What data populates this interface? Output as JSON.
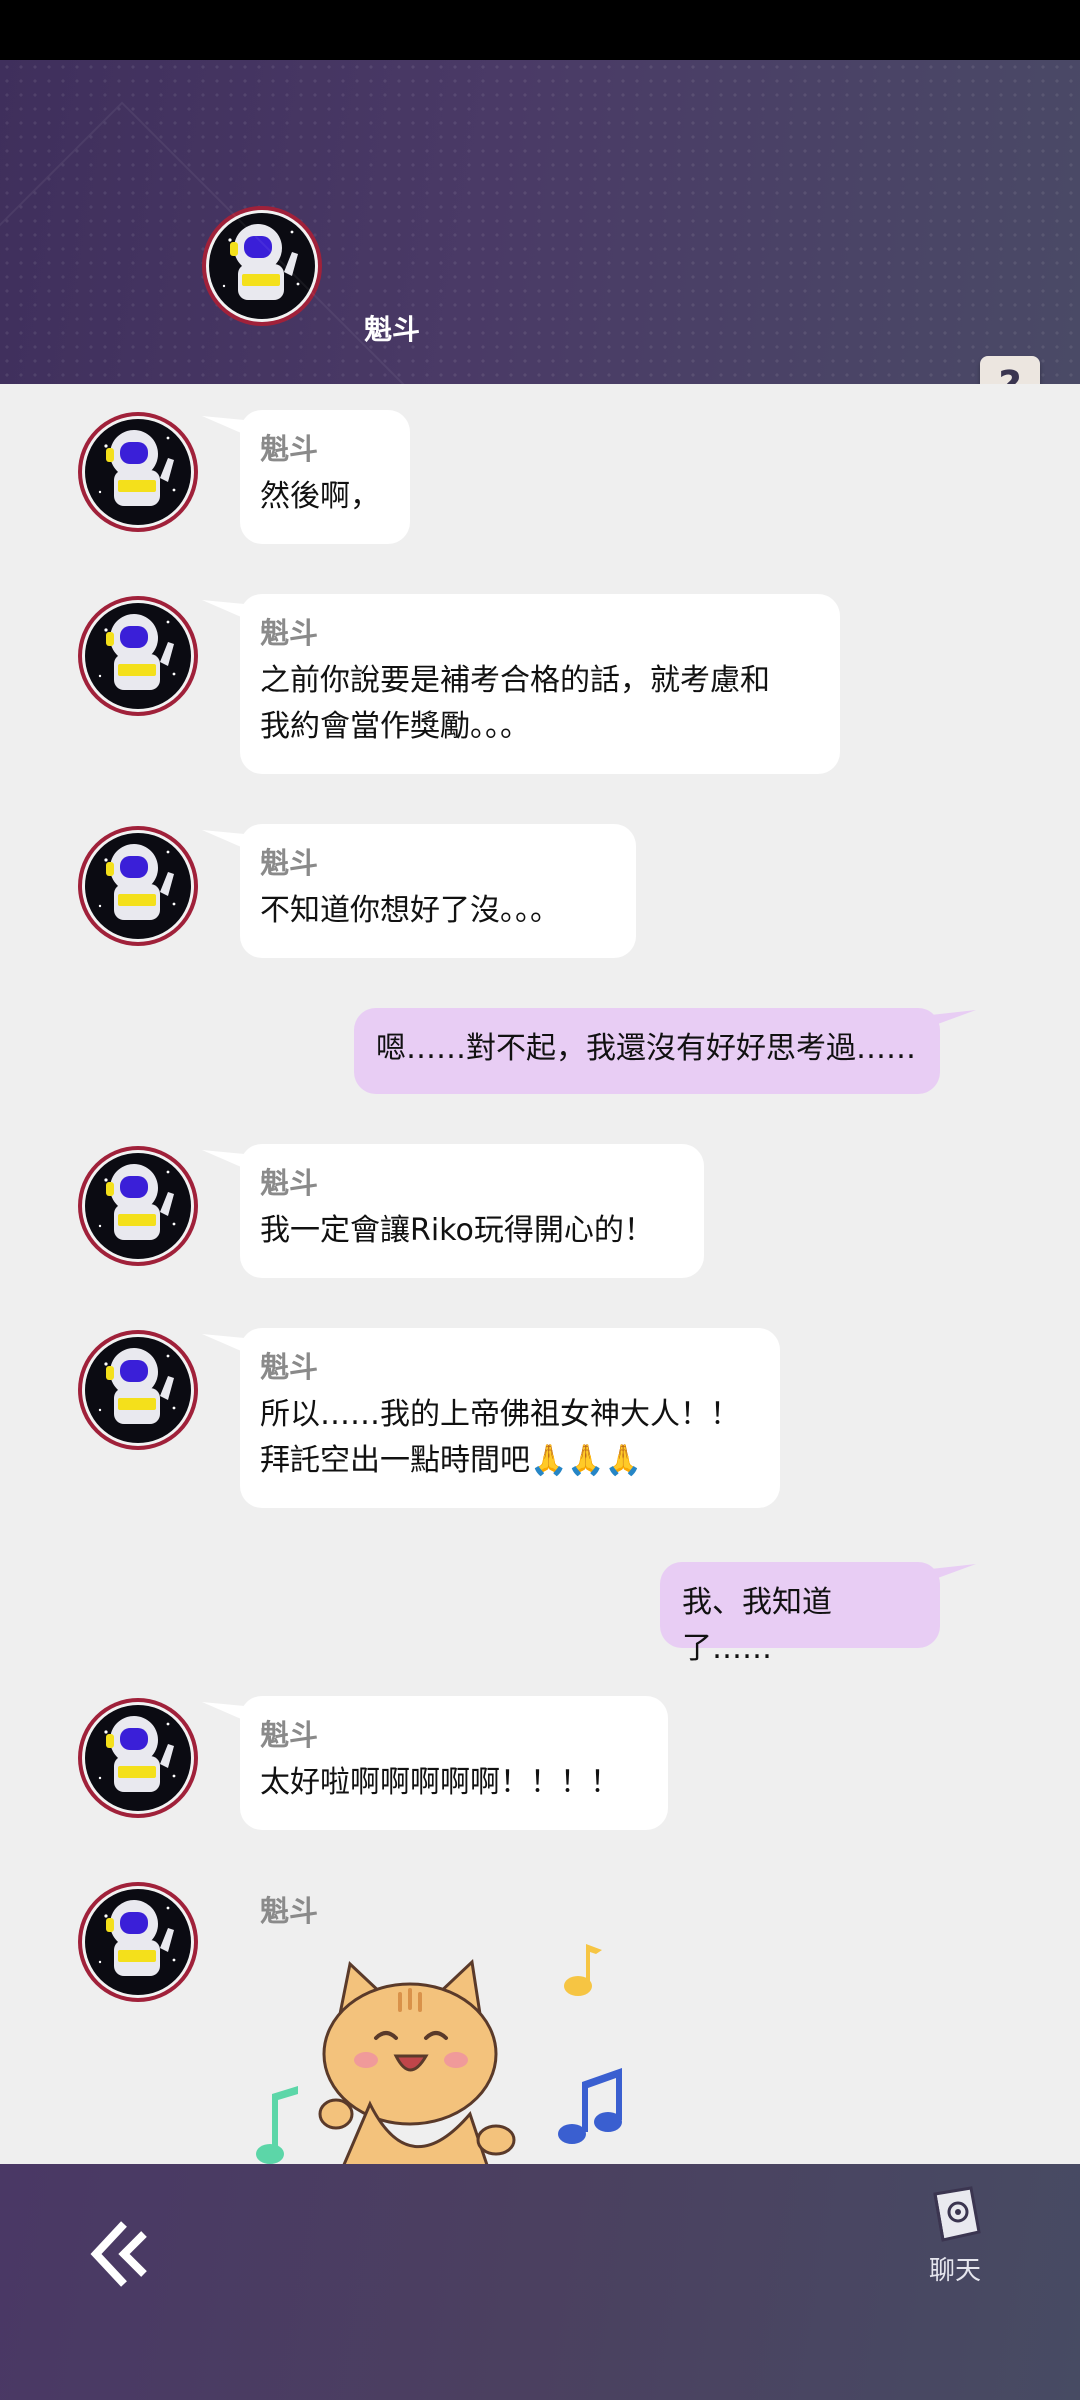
{
  "header": {
    "contact_name": "魁斗",
    "help_label": "?"
  },
  "messages": [
    {
      "side": "left",
      "sender": "魁斗",
      "text": "然後啊，"
    },
    {
      "side": "left",
      "sender": "魁斗",
      "text": "之前你說要是補考合格的話，就考慮和\n我約會當作獎勵。。。"
    },
    {
      "side": "left",
      "sender": "魁斗",
      "text": "不知道你想好了沒。。。"
    },
    {
      "side": "right",
      "text": "嗯……對不起，我還沒有好好思考過……"
    },
    {
      "side": "left",
      "sender": "魁斗",
      "text": "我一定會讓Riko玩得開心的！"
    },
    {
      "side": "left",
      "sender": "魁斗",
      "text": "所以……我的上帝佛祖女神大人！！\n拜託空出一點時間吧🙏🙏🙏"
    },
    {
      "side": "right",
      "text": "我、我知道了……"
    },
    {
      "side": "left",
      "sender": "魁斗",
      "text": "太好啦啊啊啊啊啊！！！！"
    },
    {
      "side": "left",
      "sender": "魁斗",
      "type": "sticker",
      "sticker": "cat-music-sticker"
    }
  ],
  "bottom_nav": {
    "back_icon": "back-chevron-icon",
    "chat_label": "聊天",
    "chat_icon": "chat-book-icon"
  },
  "colors": {
    "header_bg": "#4a3a66",
    "chat_bg": "#efefef",
    "incoming_bubble": "#ffffff",
    "outgoing_bubble": "#e8cdf4",
    "sender_name": "#8a8a8a"
  }
}
